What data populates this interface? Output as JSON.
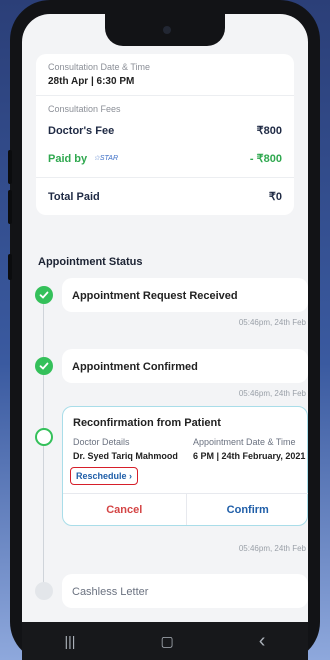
{
  "consultation": {
    "datetime_label": "Consultation Date & Time",
    "datetime_value": "28th Apr | 6:30 PM"
  },
  "fees": {
    "section_label": "Consultation Fees",
    "doctor_fee_label": "Doctor's Fee",
    "doctor_fee_value": "₹800",
    "paid_by_label": "Paid by",
    "paid_by_logo": "STAR",
    "paid_by_value": "- ₹800",
    "total_label": "Total Paid",
    "total_value": "₹0"
  },
  "status": {
    "title": "Appointment Status",
    "steps": [
      {
        "title": "Appointment Request Received",
        "timestamp": "05:46pm, 24th Feb",
        "state": "done"
      },
      {
        "title": "Appointment Confirmed",
        "timestamp": "05:46pm, 24th Feb",
        "state": "done"
      },
      {
        "title": "Reconfirmation from Patient",
        "doctor_label": "Doctor Details",
        "doctor_value": "Dr. Syed Tariq Mahmood",
        "date_label": "Appointment Date & Time",
        "date_value": "6 PM | 24th February, 2021",
        "reschedule_label": "Reschedule",
        "cancel_label": "Cancel",
        "confirm_label": "Confirm",
        "timestamp": "05:46pm, 24th Feb",
        "state": "current"
      },
      {
        "title": "Cashless Letter",
        "state": "pending"
      }
    ]
  },
  "navbar": {
    "recent_glyph": "|||",
    "home_glyph": "▢",
    "back_glyph": "‹"
  },
  "colors": {
    "green": "#34c05a",
    "blue": "#1f5ea8",
    "red": "#d44545"
  }
}
